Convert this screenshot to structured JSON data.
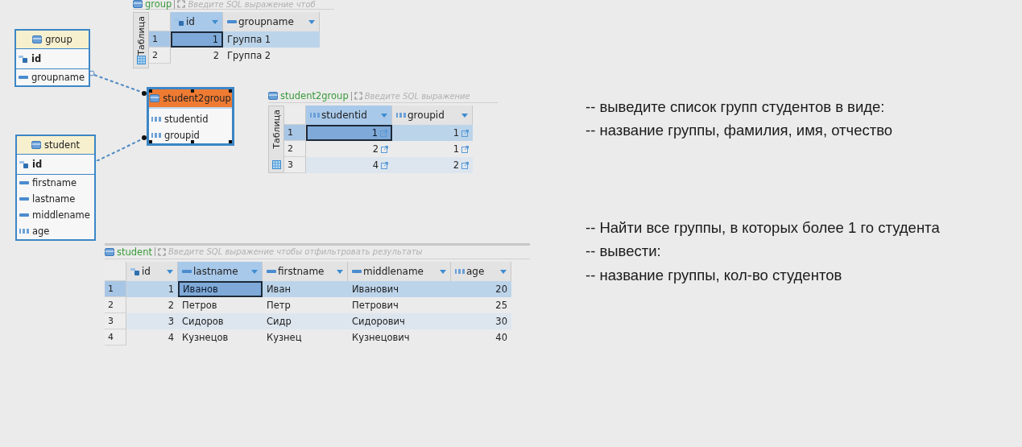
{
  "er_diagram": {
    "entities": [
      {
        "name": "group",
        "selected": false,
        "columns": [
          {
            "name": "id",
            "kind": "key"
          },
          {
            "name": "groupname",
            "kind": "text"
          }
        ]
      },
      {
        "name": "student2group",
        "selected": true,
        "columns": [
          {
            "name": "studentid",
            "kind": "number"
          },
          {
            "name": "groupid",
            "kind": "number"
          }
        ]
      },
      {
        "name": "student",
        "selected": false,
        "columns": [
          {
            "name": "id",
            "kind": "key"
          },
          {
            "name": "firstname",
            "kind": "text"
          },
          {
            "name": "lastname",
            "kind": "text"
          },
          {
            "name": "middlename",
            "kind": "text"
          },
          {
            "name": "age",
            "kind": "number"
          }
        ]
      }
    ]
  },
  "grids": [
    {
      "table": "group",
      "filter_placeholder": "Введите SQL выражение чтоб",
      "side_tab": "Таблица",
      "columns": [
        {
          "name": "id",
          "kind": "key",
          "selected": true,
          "link": false
        },
        {
          "name": "groupname",
          "kind": "text",
          "selected": false,
          "link": false
        }
      ],
      "rows": [
        {
          "number": "1",
          "selected": true,
          "cells": [
            "1",
            "Группа 1"
          ]
        },
        {
          "number": "2",
          "selected": false,
          "cells": [
            "2",
            "Группа 2"
          ]
        }
      ]
    },
    {
      "table": "student2group",
      "filter_placeholder": "Введите SQL выражение",
      "side_tab": "Таблица",
      "columns": [
        {
          "name": "studentid",
          "kind": "number",
          "selected": true,
          "link": true
        },
        {
          "name": "groupid",
          "kind": "number",
          "selected": false,
          "link": true
        }
      ],
      "rows": [
        {
          "number": "1",
          "selected": true,
          "cells": [
            "1",
            "1"
          ]
        },
        {
          "number": "2",
          "selected": false,
          "cells": [
            "2",
            "1"
          ]
        },
        {
          "number": "3",
          "selected": false,
          "cells": [
            "4",
            "2"
          ]
        }
      ]
    },
    {
      "table": "student",
      "filter_placeholder": "Введите SQL выражение чтобы отфильтровать результаты",
      "columns": [
        {
          "name": "id",
          "kind": "key",
          "selected": false,
          "link": false
        },
        {
          "name": "lastname",
          "kind": "text",
          "selected": true,
          "link": false
        },
        {
          "name": "firstname",
          "kind": "text",
          "selected": false,
          "link": false
        },
        {
          "name": "middlename",
          "kind": "text",
          "selected": false,
          "link": false
        },
        {
          "name": "age",
          "kind": "number",
          "selected": false,
          "link": false
        }
      ],
      "rows": [
        {
          "number": "1",
          "selected": true,
          "cells": [
            "1",
            "Иванов",
            "Иван",
            "Иванович",
            "20"
          ]
        },
        {
          "number": "2",
          "selected": false,
          "cells": [
            "2",
            "Петров",
            "Петр",
            "Петрович",
            "25"
          ]
        },
        {
          "number": "3",
          "selected": false,
          "cells": [
            "3",
            "Сидоров",
            "Сидр",
            "Сидорович",
            "30"
          ]
        },
        {
          "number": "4",
          "selected": false,
          "cells": [
            "4",
            "Кузнецов",
            "Кузнец",
            "Кузнецович",
            "40"
          ]
        }
      ]
    }
  ],
  "notes": [
    [
      "-- выведите список групп студентов в виде:",
      "-- название группы, фамилия, имя, отчество"
    ],
    [
      "-- Найти все группы, в которых более 1 го студента",
      "-- вывести:",
      "-- название группы, кол-во студентов"
    ]
  ]
}
